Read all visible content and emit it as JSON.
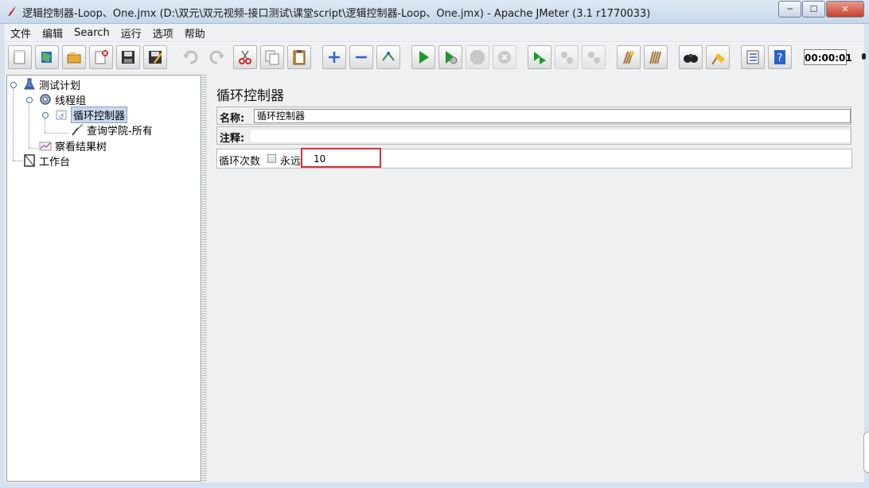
{
  "window": {
    "title": "逻辑控制器-Loop、One.jmx (D:\\双元\\双元视频-接口测试\\课堂script\\逻辑控制器-Loop、One.jmx) - Apache JMeter (3.1 r1770033)",
    "minimize": "─",
    "maximize": "☐",
    "close": "✕"
  },
  "menu": [
    "文件",
    "编辑",
    "Search",
    "运行",
    "选项",
    "帮助"
  ],
  "toolbar": {
    "timer": "00:00:01",
    "buttons": [
      "new-icon",
      "templates-icon",
      "open-icon",
      "close-plan-icon",
      "save-icon",
      "save-as-icon",
      "undo-icon",
      "redo-icon",
      "cut-icon",
      "copy-icon",
      "paste-icon",
      "expand-icon",
      "collapse-icon",
      "toggle-icon",
      "start-icon",
      "start-no-pause-icon",
      "stop-icon",
      "shutdown-icon",
      "remote-start-icon",
      "remote-stop-icon",
      "remote-shutdown-icon",
      "clear-icon",
      "clear-all-icon",
      "search-icon",
      "reset-search-icon",
      "function-helper-icon",
      "help-icon"
    ]
  },
  "tree": {
    "nodes": [
      {
        "label": "测试计划",
        "icon": "test-plan-icon"
      },
      {
        "label": "线程组",
        "icon": "thread-group-icon"
      },
      {
        "label": "循环控制器",
        "icon": "loop-controller-icon",
        "selected": true
      },
      {
        "label": "查询学院-所有",
        "icon": "http-sampler-icon"
      },
      {
        "label": "察看结果树",
        "icon": "results-tree-icon"
      },
      {
        "label": "工作台",
        "icon": "workbench-icon"
      }
    ]
  },
  "panel": {
    "title": "循环控制器",
    "name_label": "名称:",
    "name_value": "循环控制器",
    "comment_label": "注释:",
    "comment_value": "",
    "loop_label": "循环次数",
    "forever_label": "永远",
    "forever_checked": false,
    "loop_count": "10"
  },
  "colors": {
    "highlight_border": "#d9303a",
    "selection": "#c7d9ee",
    "accent_green": "#1a9a2a"
  }
}
